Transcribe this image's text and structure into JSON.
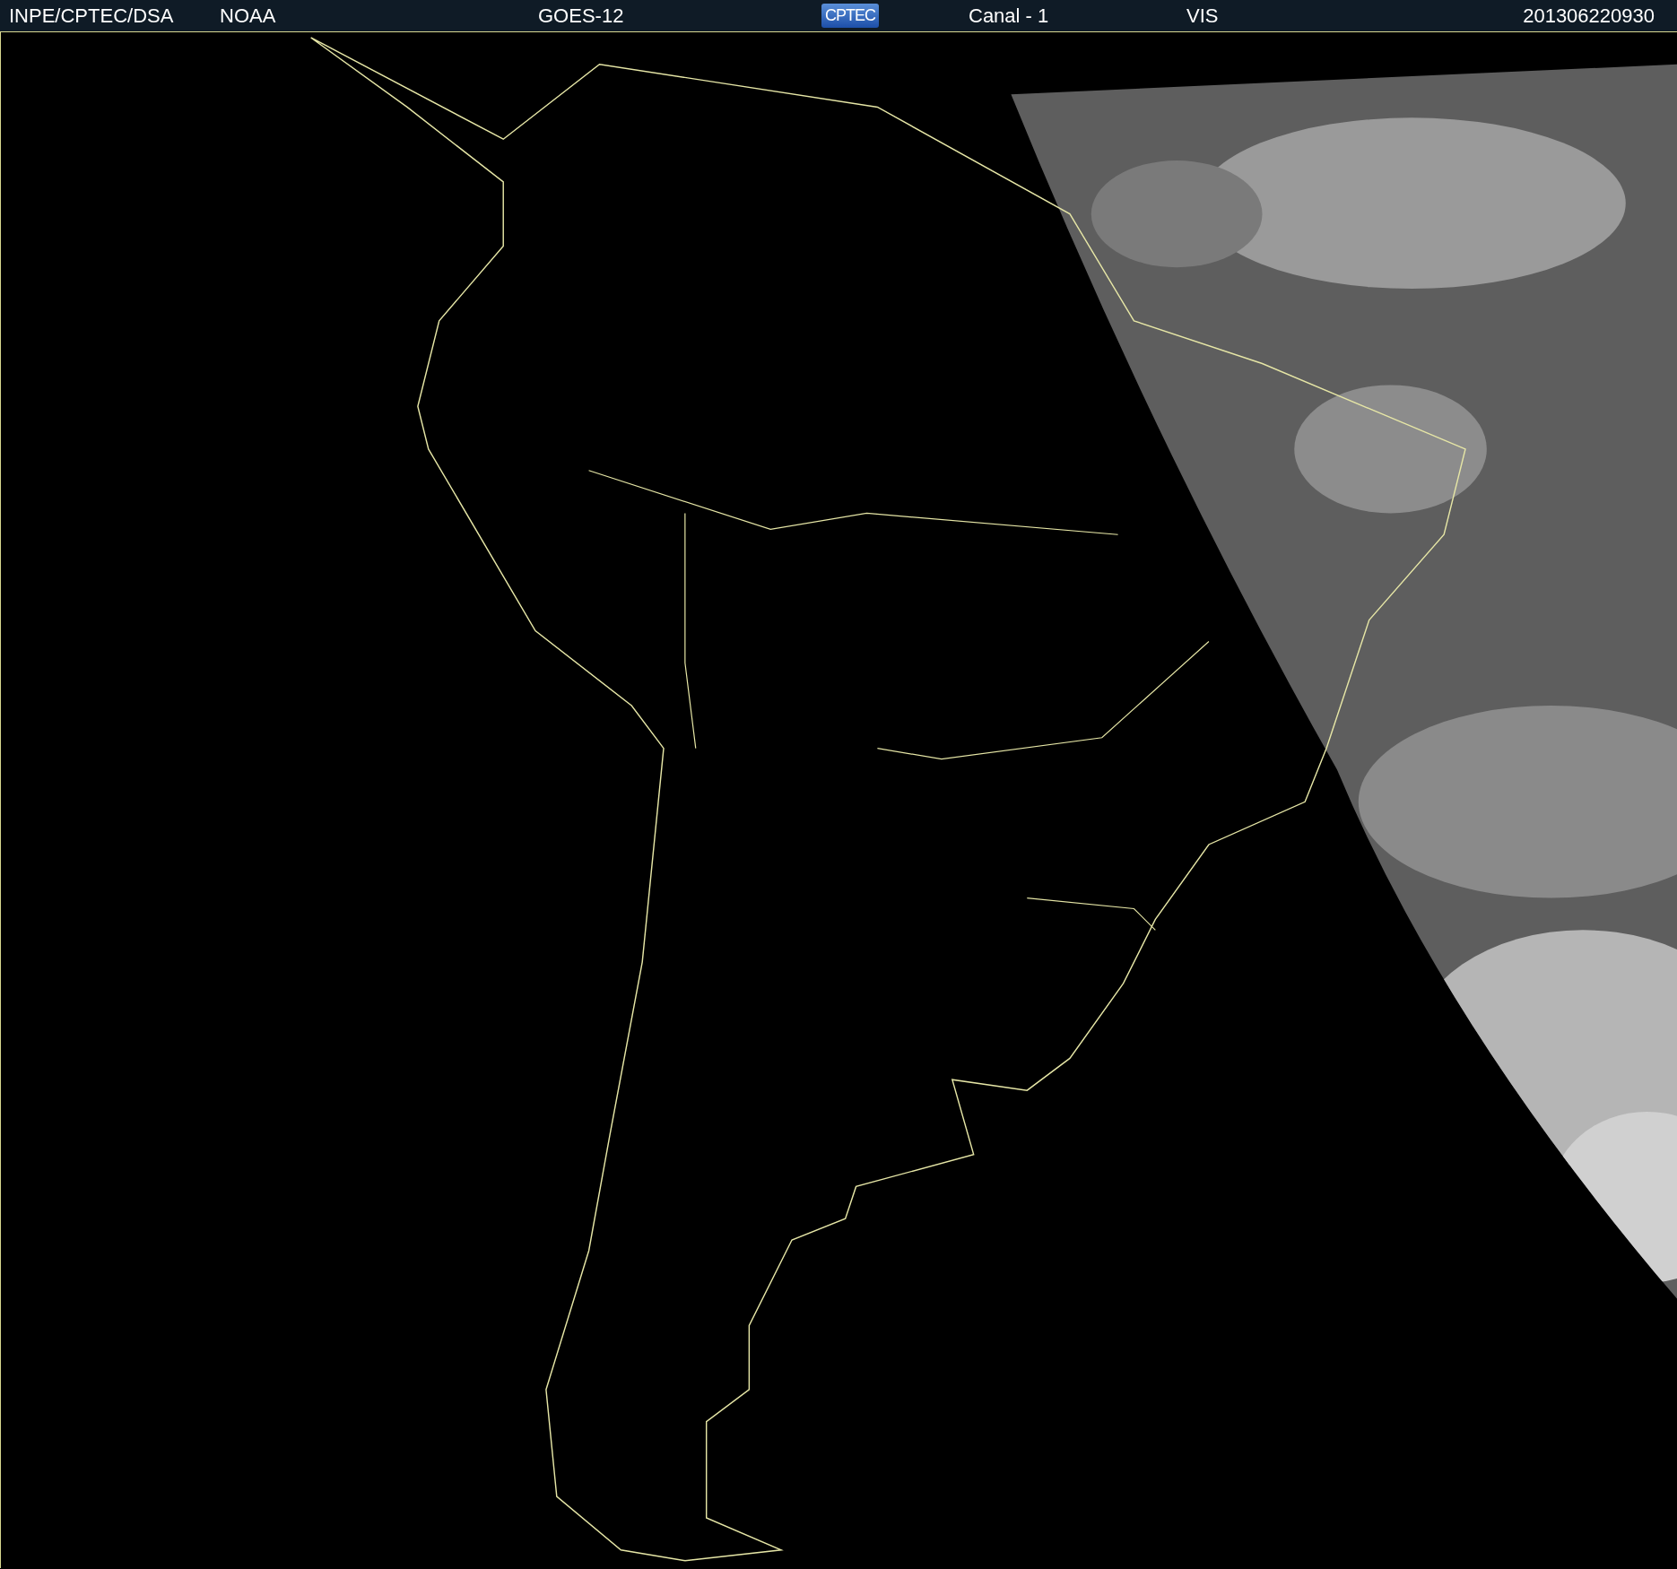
{
  "header": {
    "source": "INPE/CPTEC/DSA",
    "agency": "NOAA",
    "satellite": "GOES-12",
    "logo": "CPTEC",
    "channel": "Canal - 1",
    "band": "VIS",
    "timestamp": "201306220930"
  }
}
